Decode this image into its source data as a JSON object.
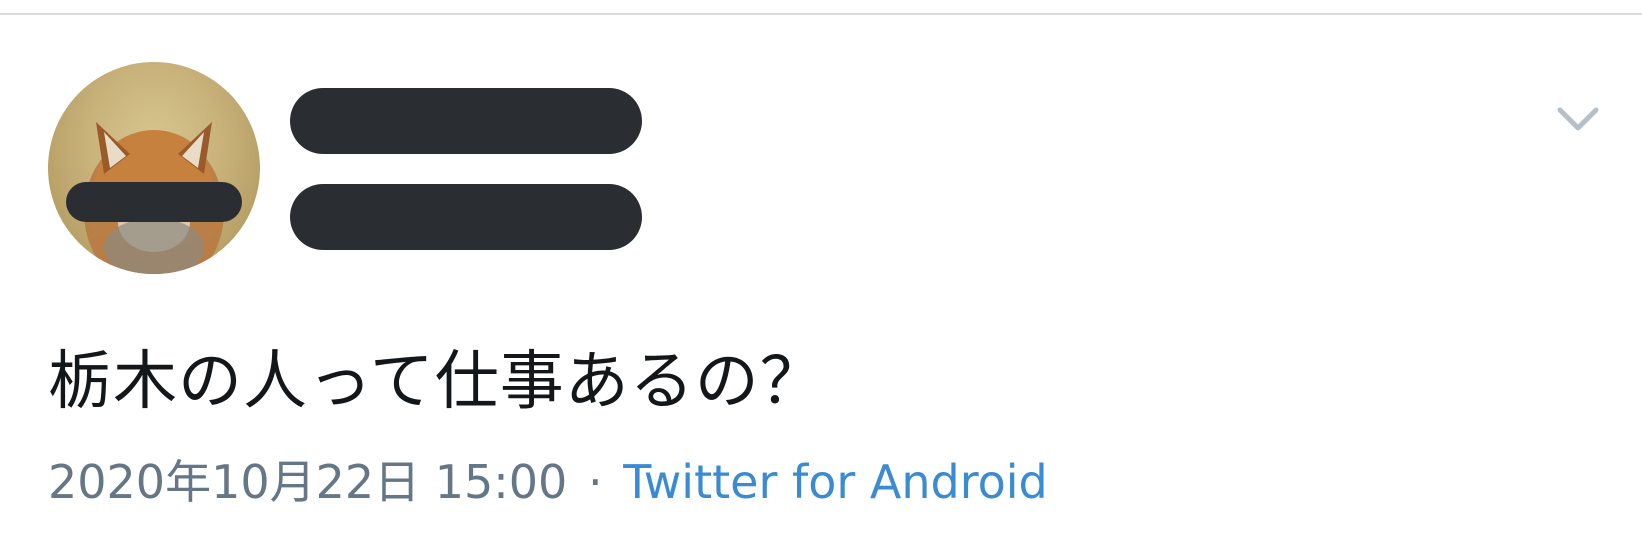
{
  "tweet": {
    "text": "栃木の人って仕事あるの？",
    "timestamp": "2020年10月22日 15:00",
    "separator": "·",
    "source": "Twitter for Android"
  },
  "icons": {
    "menu": "chevron-down-icon",
    "avatar": "fox-avatar"
  },
  "colors": {
    "redaction": "#2a2e33",
    "meta_text": "#657786",
    "link": "#3a8bd2",
    "body_text": "#14171a"
  }
}
